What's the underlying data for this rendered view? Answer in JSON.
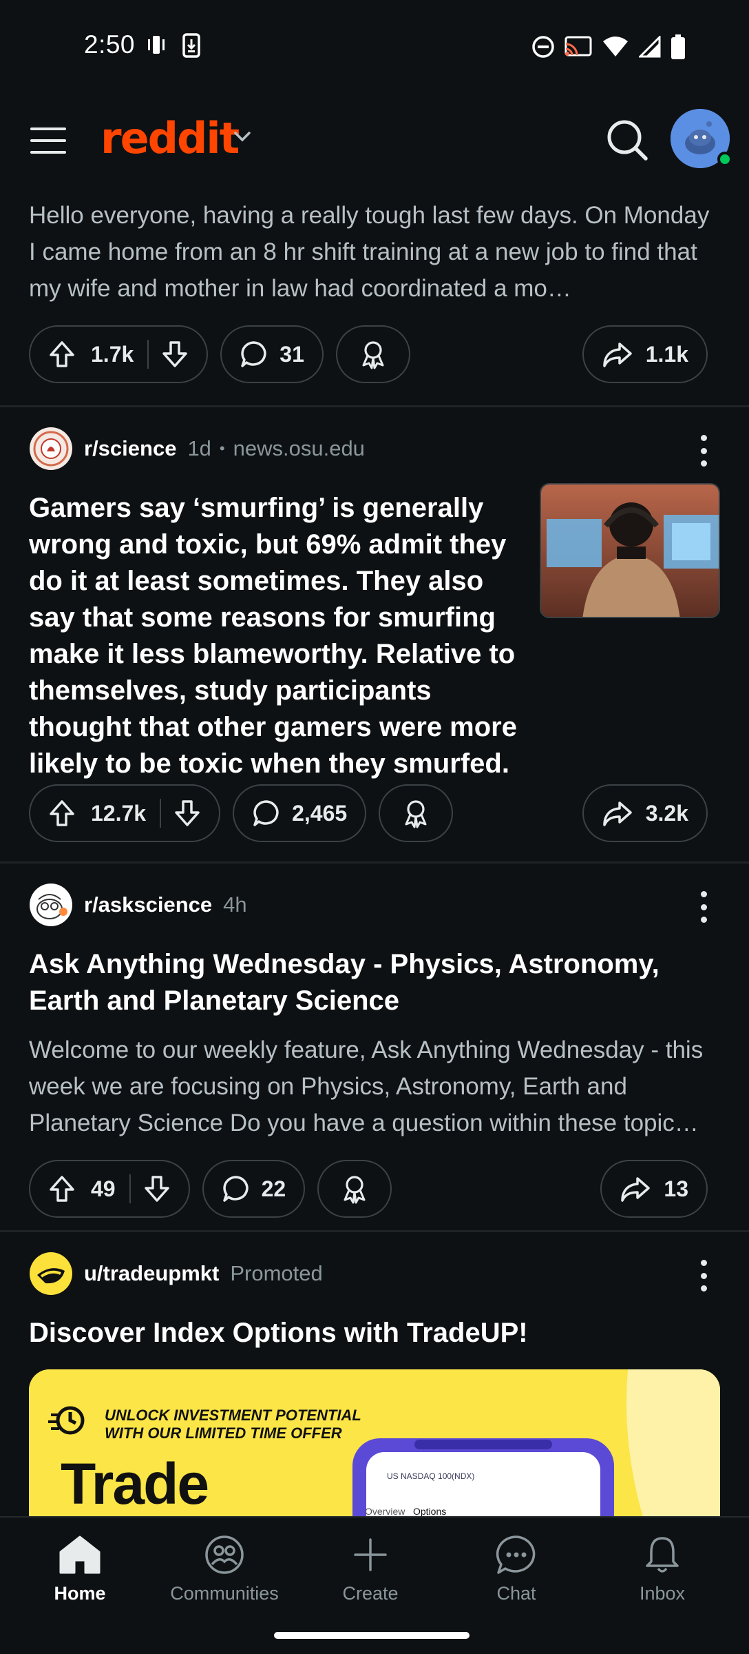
{
  "status_bar": {
    "time": "2:50"
  },
  "header": {
    "logo_text": "reddit",
    "colors": {
      "brand": "#ff4500",
      "online": "#00c85a"
    }
  },
  "posts": [
    {
      "body": "Hello everyone, having a really tough last few days. On Monday I came home from an 8 hr shift training at a new job to find that my wife and mother in law had coordinated a mo…",
      "upvotes": "1.7k",
      "comments": "31",
      "shares": "1.1k"
    },
    {
      "subreddit": "r/science",
      "age": "1d",
      "domain": "news.osu.edu",
      "separator": "•",
      "title": "Gamers say ‘smurfing’ is generally wrong and toxic, but 69% admit they do it at least sometimes. They also say that some reasons for smurfing make it less blameworthy. Relative to themselves, study participants thought that other gamers were more likely to be toxic when they smurfed.",
      "upvotes": "12.7k",
      "comments": "2,465",
      "shares": "3.2k"
    },
    {
      "subreddit": "r/askscience",
      "age": "4h",
      "title": "Ask Anything Wednesday - Physics, Astronomy, Earth and Planetary Science",
      "body": "Welcome to our weekly feature, Ask Anything Wednesday - this week we are focusing on Physics, Astronomy, Earth and Planetary Science Do you have a question within these topic…",
      "upvotes": "49",
      "comments": "22",
      "shares": "13"
    },
    {
      "user": "u/tradeupmkt",
      "promoted": "Promoted",
      "title": "Discover Index Options with TradeUP!",
      "ad_tagline_1": "UNLOCK INVESTMENT POTENTIAL",
      "ad_tagline_2": "WITH OUR LIMITED TIME OFFER",
      "ad_headline": "Trade",
      "ad_phone_ticker": "US NASDAQ 100(NDX)",
      "ad_phone_tab_1": "Overview",
      "ad_phone_tab_2": "Options"
    }
  ],
  "bottom_nav": [
    {
      "label": "Home",
      "icon": "home-icon",
      "active": true
    },
    {
      "label": "Communities",
      "icon": "communities-icon"
    },
    {
      "label": "Create",
      "icon": "plus-icon"
    },
    {
      "label": "Chat",
      "icon": "chat-icon"
    },
    {
      "label": "Inbox",
      "icon": "bell-icon"
    }
  ]
}
